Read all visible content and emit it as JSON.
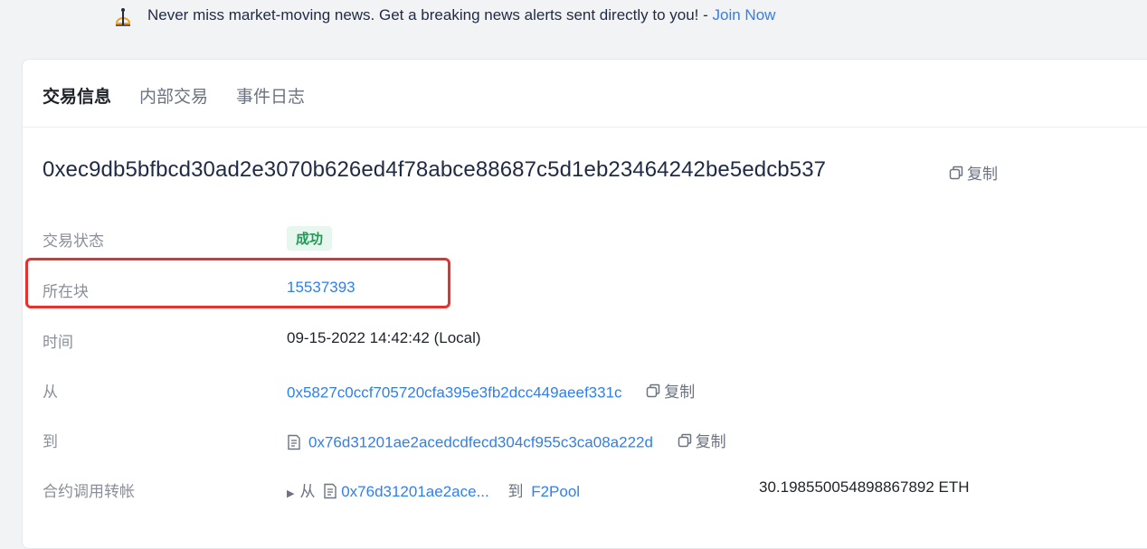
{
  "banner": {
    "message": "Never miss market-moving news. Get a breaking news alerts sent directly to you! - ",
    "link": "Join Now"
  },
  "tabs": [
    "交易信息",
    "内部交易",
    "事件日志"
  ],
  "tx_hash": "0xec9db5bfbcd30ad2e3070b626ed4f78abce88687c5d1eb23464242be5edcb537",
  "copy_label": "复制",
  "rows": {
    "status": {
      "label": "交易状态",
      "value": "成功"
    },
    "block": {
      "label": "所在块",
      "value": "15537393"
    },
    "time": {
      "label": "时间",
      "value": "09-15-2022 14:42:42 (Local)"
    },
    "from": {
      "label": "从",
      "value": "0x5827c0ccf705720cfa395e3fb2dcc449aeef331c"
    },
    "to": {
      "label": "到",
      "value": "0x76d31201ae2acedcdfecd304cf955c3ca08a222d"
    },
    "internal": {
      "label": "合约调用转帐",
      "from_word": "从",
      "from_addr": "0x76d31201ae2ace...",
      "to_word": "到",
      "to_name": "F2Pool",
      "amount": "30.198550054898867892 ETH"
    }
  },
  "colors": {
    "accent": "#2f7ff0",
    "success": "#1f9a55",
    "highlight": "#e8312a"
  }
}
